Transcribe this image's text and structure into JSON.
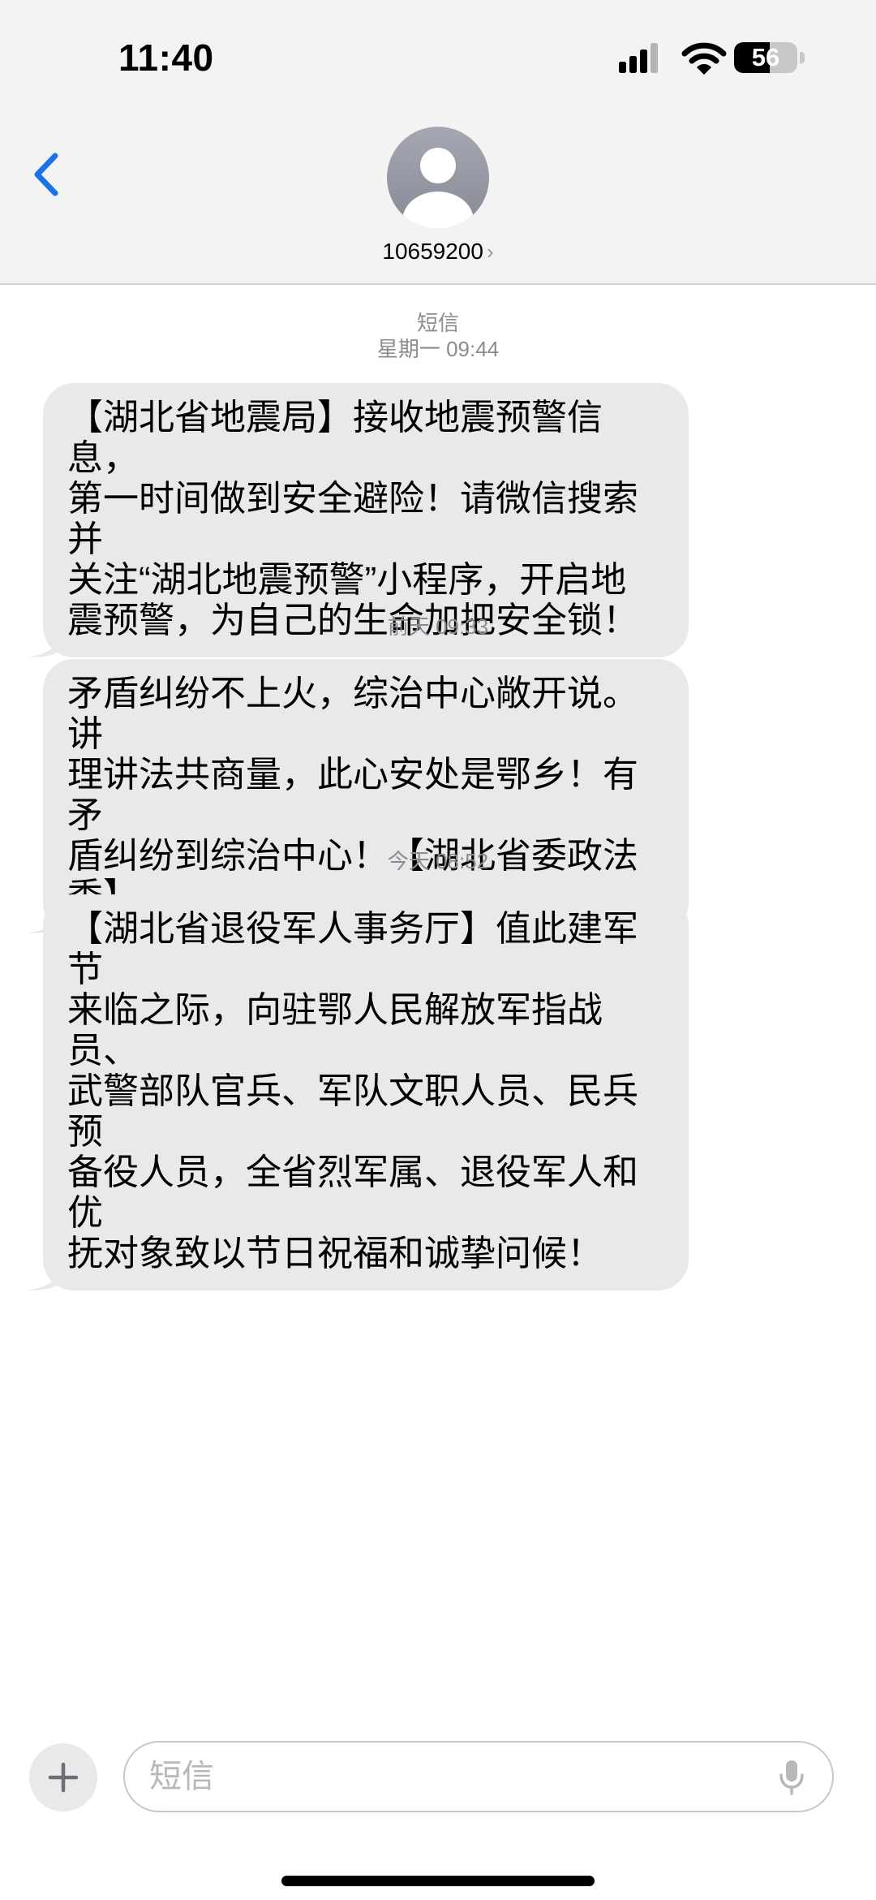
{
  "status_bar": {
    "time": "11:40",
    "battery_level": "56",
    "battery_fraction": 0.56
  },
  "header": {
    "contact_name": "10659200",
    "chevron": "›"
  },
  "messages": [
    {
      "timestamp_label": "短信",
      "timestamp": "星期一 09:44",
      "lines": [
        "【湖北省地震局】接收地震预警信息，",
        "第一时间做到安全避险！请微信搜索并",
        "关注“湖北地震预警”小程序，开启地",
        "震预警，为自己的生命加把安全锁！"
      ]
    },
    {
      "timestamp": "前天 09:33",
      "lines": [
        "矛盾纠纷不上火，综治中心敞开说。讲",
        "理讲法共商量，此心安处是鄂乡！有矛",
        "盾纠纷到综治中心！【湖北省委政法委】"
      ]
    },
    {
      "timestamp": "今天 08:52",
      "lines": [
        "【湖北省退役军人事务厅】值此建军节",
        "来临之际，向驻鄂人民解放军指战员、",
        "武警部队官兵、军队文职人员、民兵预",
        "备役人员，全省烈军属、退役军人和优",
        "抚对象致以节日祝福和诚挚问候！"
      ]
    }
  ],
  "composer": {
    "placeholder": "短信"
  },
  "icons": {
    "back": "chevron-left-icon",
    "avatar": "person-icon",
    "plus": "plus-icon",
    "mic": "microphone-icon",
    "signal": "cellular-signal-icon",
    "wifi": "wifi-icon",
    "battery": "battery-icon"
  },
  "colors": {
    "accent": "#1a73e8",
    "bubble": "#e9e9eb",
    "header_bg": "#f3f3f4",
    "timestamp": "#8b8b90"
  }
}
